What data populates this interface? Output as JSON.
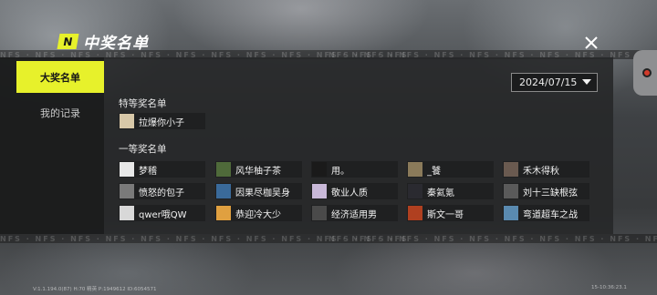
{
  "header": {
    "logo_letter": "N",
    "title": "中奖名单"
  },
  "sidebar": {
    "items": [
      {
        "label": "大奖名单",
        "active": true
      },
      {
        "label": "我的记录",
        "active": false
      }
    ]
  },
  "date_filter": {
    "selected": "2024/07/15"
  },
  "special_prize": {
    "title": "特等奖名单",
    "winners": [
      {
        "name": "拉爆你小子",
        "avatar_color": "#d8c8a8"
      }
    ]
  },
  "first_prize": {
    "title": "一等奖名单",
    "winners": [
      {
        "name": "梦稽",
        "avatar_color": "#e8e8e8"
      },
      {
        "name": "风华柚子茶",
        "avatar_color": "#4f6a3a"
      },
      {
        "name": "用。",
        "avatar_color": "#1a1a1a"
      },
      {
        "name": "_饕",
        "avatar_color": "#8a7a5a"
      },
      {
        "name": "禾木得秋",
        "avatar_color": "#6a5a50"
      },
      {
        "name": "愤怒的包子",
        "avatar_color": "#7a7a7a"
      },
      {
        "name": "因果尽枷吴身",
        "avatar_color": "#3a6a9a"
      },
      {
        "name": "敬业人质",
        "avatar_color": "#c8b8d8"
      },
      {
        "name": "秦氦氪",
        "avatar_color": "#2a2a30"
      },
      {
        "name": "刘十三缺根弦",
        "avatar_color": "#5a5a5a"
      },
      {
        "name": "qwer哦QW",
        "avatar_color": "#d8d8d8"
      },
      {
        "name": "恭迎冷大少",
        "avatar_color": "#e0a040"
      },
      {
        "name": "经济适用男",
        "avatar_color": "#4a4a4a"
      },
      {
        "name": "斯文一哥",
        "avatar_color": "#b04020"
      },
      {
        "name": "弯道超车之战",
        "avatar_color": "#5a8ab0"
      }
    ]
  },
  "band_text": "NFS · NFS · NFS · NFS · NFS · NFS · NFS · NFS · NFS · NFS · NFS · NFS",
  "footer": {
    "left": "V:1.1.194.0(87) H:70 精英 P:1949612 ID:6054571",
    "right": "15-10:36:23.1"
  },
  "colors": {
    "accent": "#e7f12b",
    "panel": "#262728"
  }
}
